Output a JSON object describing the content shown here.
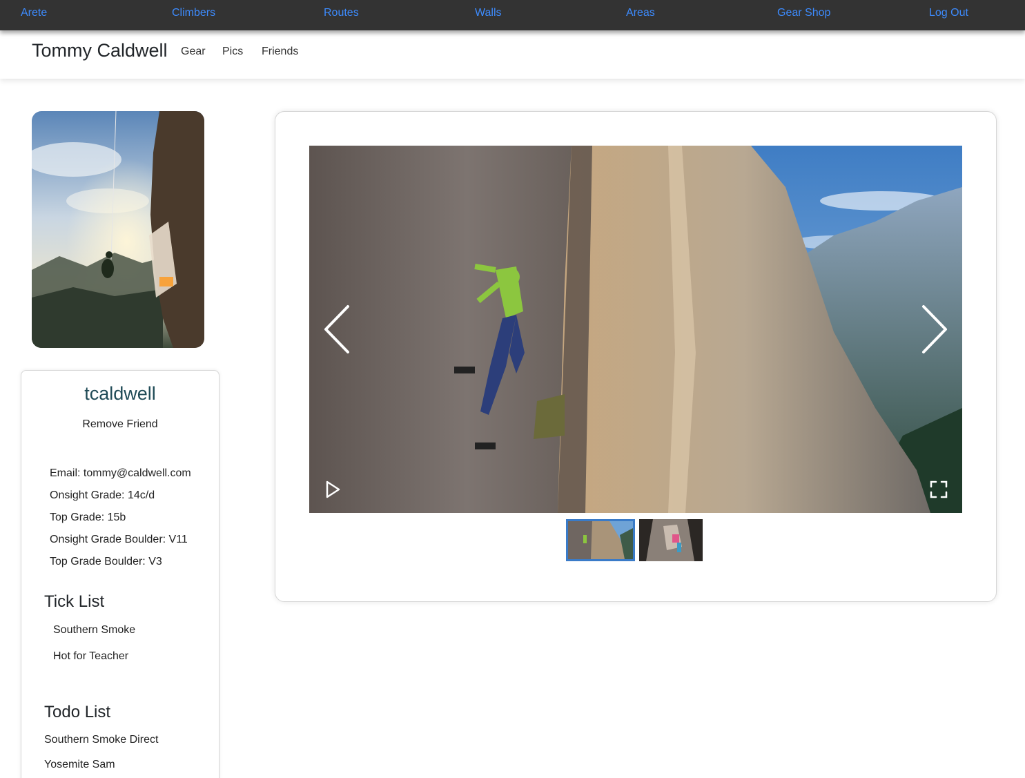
{
  "topnav": {
    "items": [
      "Arete",
      "Climbers",
      "Routes",
      "Walls",
      "Areas",
      "Gear Shop",
      "Log Out"
    ]
  },
  "subheader": {
    "name": "Tommy Caldwell",
    "links": [
      "Gear",
      "Pics",
      "Friends"
    ]
  },
  "profile": {
    "username": "tcaldwell",
    "action": "Remove Friend",
    "stats": [
      "Email: tommy@caldwell.com",
      "Onsight Grade: 14c/d",
      "Top Grade: 15b",
      "Onsight Grade Boulder: V11",
      "Top Grade Boulder: V3"
    ],
    "tick_title": "Tick List",
    "ticks": [
      "Southern Smoke",
      "Hot for Teacher"
    ],
    "todo_title": "Todo List",
    "todos": [
      "Southern Smoke Direct",
      "Yosemite Sam"
    ]
  },
  "gallery": {
    "icons": [
      "chevron-left-icon",
      "chevron-right-icon",
      "play-icon",
      "fullscreen-icon"
    ],
    "thumbnails": 2,
    "active_thumbnail": 1
  },
  "colors": {
    "nav_bg": "#333333",
    "nav_link": "#3d8bfd",
    "username": "#1f4a56",
    "thumb_active": "#3a7bc8"
  }
}
